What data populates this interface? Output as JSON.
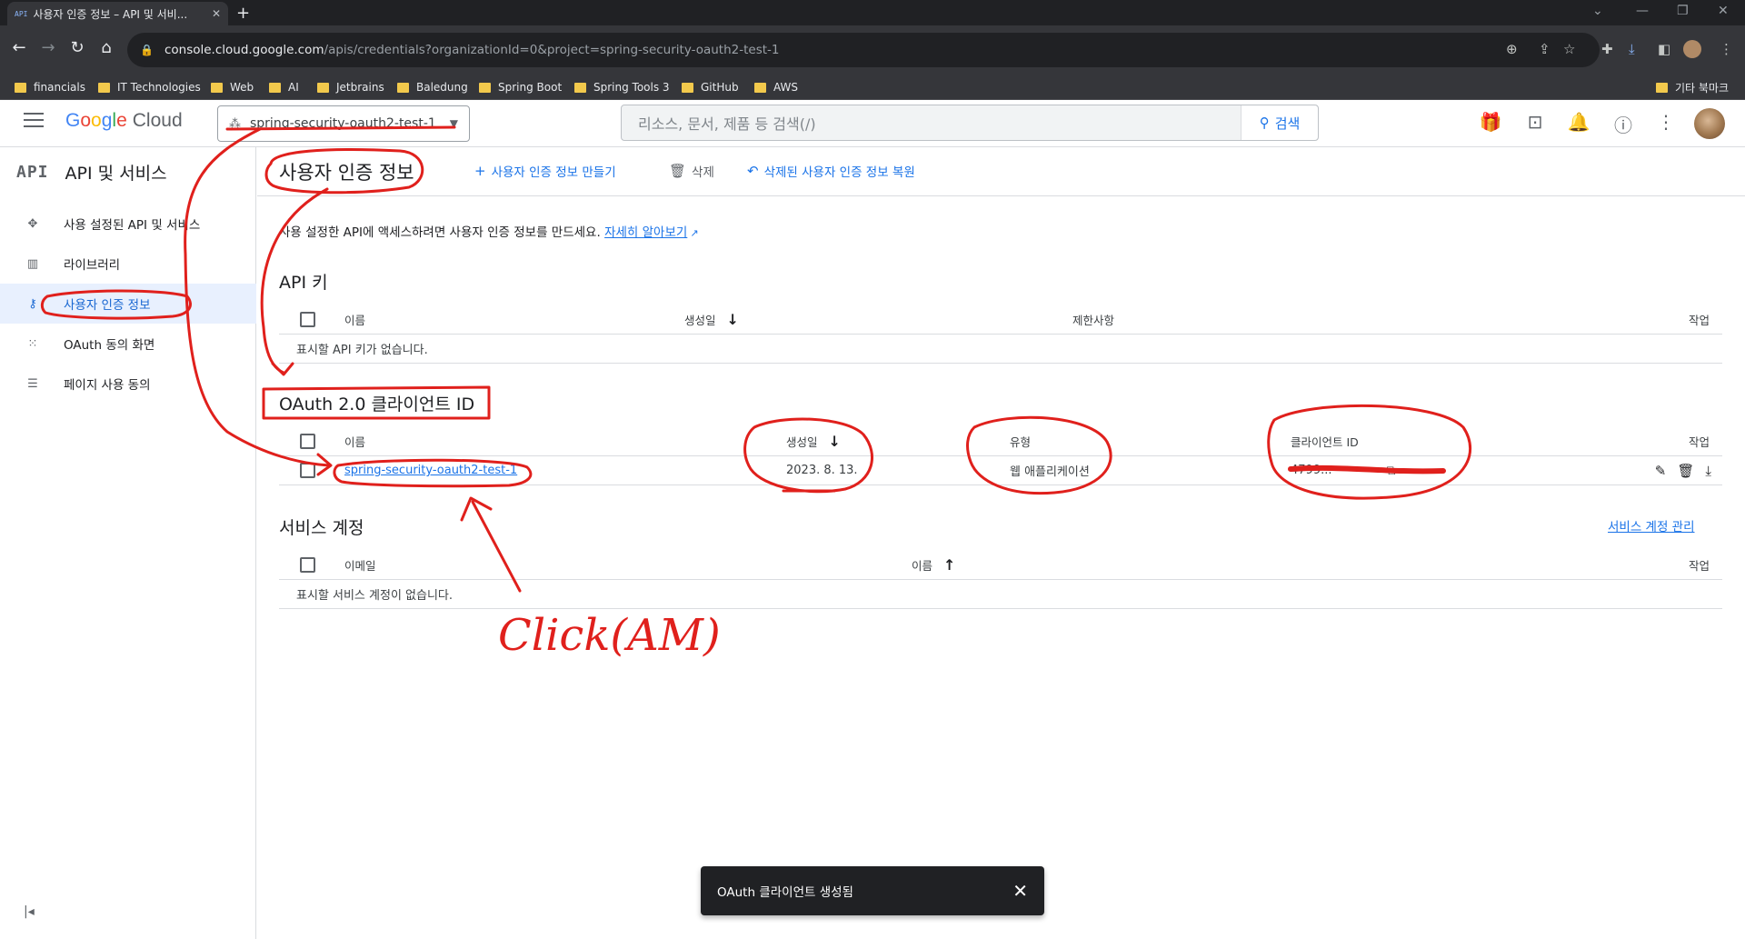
{
  "browser": {
    "tab_title": "사용자 인증 정보 – API 및 서비...",
    "tab_favicon": "API",
    "url_host": "console.cloud.google.com",
    "url_path": "/apis/credentials?organizationId=0&project=spring-security-oauth2-test-1",
    "bookmarks": [
      "financials",
      "IT Technologies",
      "Web",
      "AI",
      "Jetbrains",
      "Baledung",
      "Spring Boot",
      "Spring Tools 3",
      "GitHub",
      "AWS"
    ],
    "other_bookmarks": "기타 북마크"
  },
  "header": {
    "logo_google": [
      "G",
      "o",
      "o",
      "g",
      "l",
      "e"
    ],
    "logo_cloud": "Cloud",
    "project": "spring-security-oauth2-test-1",
    "search_placeholder": "리소스, 문서, 제품 등 검색(/)",
    "search_button": "검색"
  },
  "sidebar": {
    "logo": "API",
    "title": "API 및 서비스",
    "items": [
      {
        "label": "사용 설정된 API 및 서비스",
        "icon": "move-icon"
      },
      {
        "label": "라이브러리",
        "icon": "library-icon"
      },
      {
        "label": "사용자 인증 정보",
        "icon": "key-icon"
      },
      {
        "label": "OAuth 동의 화면",
        "icon": "consent-icon"
      },
      {
        "label": "페이지 사용 동의",
        "icon": "settings-list-icon"
      }
    ],
    "active_index": 2
  },
  "toolbar": {
    "title": "사용자 인증 정보",
    "create": "사용자 인증 정보 만들기",
    "delete": "삭제",
    "restore": "삭제된 사용자 인증 정보 복원"
  },
  "description": {
    "text": "사용 설정한 API에 액세스하려면 사용자 인증 정보를 만드세요.",
    "link": "자세히 알아보기"
  },
  "api_keys": {
    "title": "API 키",
    "columns": [
      "이름",
      "생성일",
      "제한사항",
      "작업"
    ],
    "empty": "표시할 API 키가 없습니다."
  },
  "oauth_clients": {
    "title": "OAuth 2.0 클라이언트 ID",
    "columns": [
      "이름",
      "생성일",
      "유형",
      "클라이언트 ID",
      "작업"
    ],
    "rows": [
      {
        "name": "spring-security-oauth2-test-1",
        "created": "2023. 8. 13.",
        "type": "웹 애플리케이션",
        "client_id": "4799..."
      }
    ]
  },
  "service_accounts": {
    "title": "서비스 계정",
    "manage": "서비스 계정 관리",
    "columns": [
      "이메일",
      "이름",
      "작업"
    ],
    "empty": "표시할 서비스 계정이 없습니다."
  },
  "toast": {
    "message": "OAuth 클라이언트 생성됨"
  },
  "annotation": {
    "text": "Click(AM)",
    "color": "#e0201c"
  }
}
